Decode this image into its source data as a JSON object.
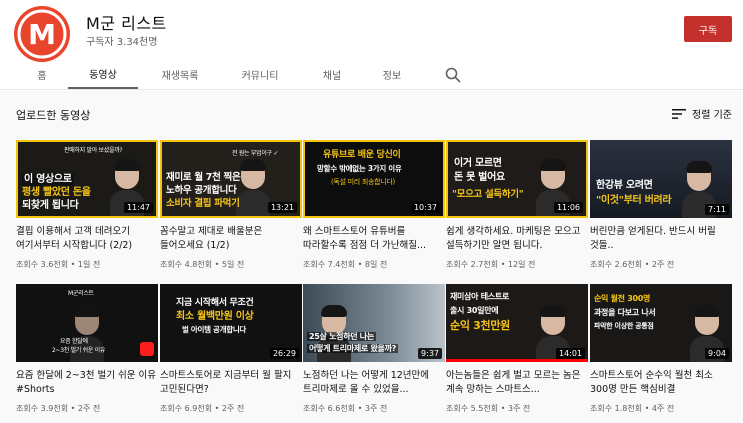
{
  "channel": {
    "logo_letter": "M",
    "name": "M군 리스트",
    "subscribers": "구독자 3.34천명",
    "subscribe_label": "구독",
    "brand_color": "#e8452c"
  },
  "tabs": [
    {
      "label": "홈",
      "active": false
    },
    {
      "label": "동영상",
      "active": true
    },
    {
      "label": "재생목록",
      "active": false
    },
    {
      "label": "커뮤니티",
      "active": false
    },
    {
      "label": "채널",
      "active": false
    },
    {
      "label": "정보",
      "active": false
    }
  ],
  "search_icon": "search-icon",
  "section": {
    "title": "업로드한 동영상",
    "sort_label": "정렬 기준",
    "sort_icon": "sort-icon"
  },
  "videos": [
    {
      "title": "결핍 이용해서 고객 데려오기 여기서부터 시작합니다 (2/2)",
      "views": "조회수 3.6천회",
      "age": "1일 전",
      "duration": "11:47",
      "caption_top": "판매하지 말아 보셨을까?",
      "caption_lines": [
        "이 영상으로",
        "평생 빨았던 돈을",
        "되찾게 됩니다"
      ]
    },
    {
      "title": "꼼수말고 제대로 배울분은 들어오세요 (1/2)",
      "views": "조회수 4.8천회",
      "age": "5일 전",
      "duration": "13:21",
      "caption_top": "전 원는 부업이구 ✓",
      "caption_lines": [
        "재미로 월 7천 찍은",
        "노하우 공개합니다",
        "소비자 결핍 파먹기"
      ]
    },
    {
      "title": "왜 스마트스토어 유튜버를 따라할수록 점점 더 가난해질...",
      "views": "조회수 7.4천회",
      "age": "8일 전",
      "duration": "10:37",
      "caption_top": "",
      "caption_lines": [
        "유튜브로 배운 당신이",
        "망할수 밖에없는 3가지 이유",
        "(독설 미리 죄송합니다)"
      ]
    },
    {
      "title": "쉽게 생각하세요. 마케팅은 모으고 설득하기만 알면 됩니다.",
      "views": "조회수 2.7천회",
      "age": "12일 전",
      "duration": "11:06",
      "caption_top": "",
      "caption_lines": [
        "이거 모르면",
        "돈 못 벌어요",
        "\"모으고 설득하기\""
      ]
    },
    {
      "title": "버린만큼 얻게된다. 반드시 버릴 것들..",
      "views": "조회수 2.6천회",
      "age": "2주 전",
      "duration": "7:11",
      "caption_top": "",
      "caption_lines": [
        "한강뷰 오려면",
        "\"이것\"부터 버려라"
      ]
    },
    {
      "title": "요즘 한달에 2~3천 벌기 쉬운 이유 #Shorts",
      "views": "조회수 3.9천회",
      "age": "2주 전",
      "duration": "",
      "caption_top": "M군리스트",
      "caption_lines": [
        "요즘 한달에",
        "2~3천 벌기 쉬운 이유"
      ]
    },
    {
      "title": "스마트스토어로 지금부터 월 팔지 고민된다면?",
      "views": "조회수 6.9천회",
      "age": "2주 전",
      "duration": "26:29",
      "caption_top": "",
      "caption_lines": [
        "지금 시작해서 무조건",
        "최소 월백만원 이상",
        "벌 아이템 공개합니다"
      ]
    },
    {
      "title": "노점하던 나는 어떻게 12년만에 트리마제로 올 수 있었을...",
      "views": "조회수 6.6천회",
      "age": "3주 전",
      "duration": "9:37",
      "caption_top": "",
      "caption_lines": [
        "25살 노점하던 나는",
        "어떻게 트리마제로 왔을까?"
      ]
    },
    {
      "title": "아는놈들은 쉽게 벌고 모르는 놈은 계속 망하는 스마트스...",
      "views": "조회수 5.5천회",
      "age": "3주 전",
      "duration": "14:01",
      "caption_top": "",
      "caption_lines": [
        "재미삼아 테스트로",
        "출시 30일만에",
        "순익 3천만원"
      ]
    },
    {
      "title": "스마트스토어 순수익 월천 최소 300명 만든 핵심비결",
      "views": "조회수 1.8천회",
      "age": "4주 전",
      "duration": "9:04",
      "caption_top": "",
      "caption_lines": [
        "순익 월천 300명",
        "과정을 다보고 나서",
        "파악한 이상한 공통점"
      ]
    }
  ]
}
